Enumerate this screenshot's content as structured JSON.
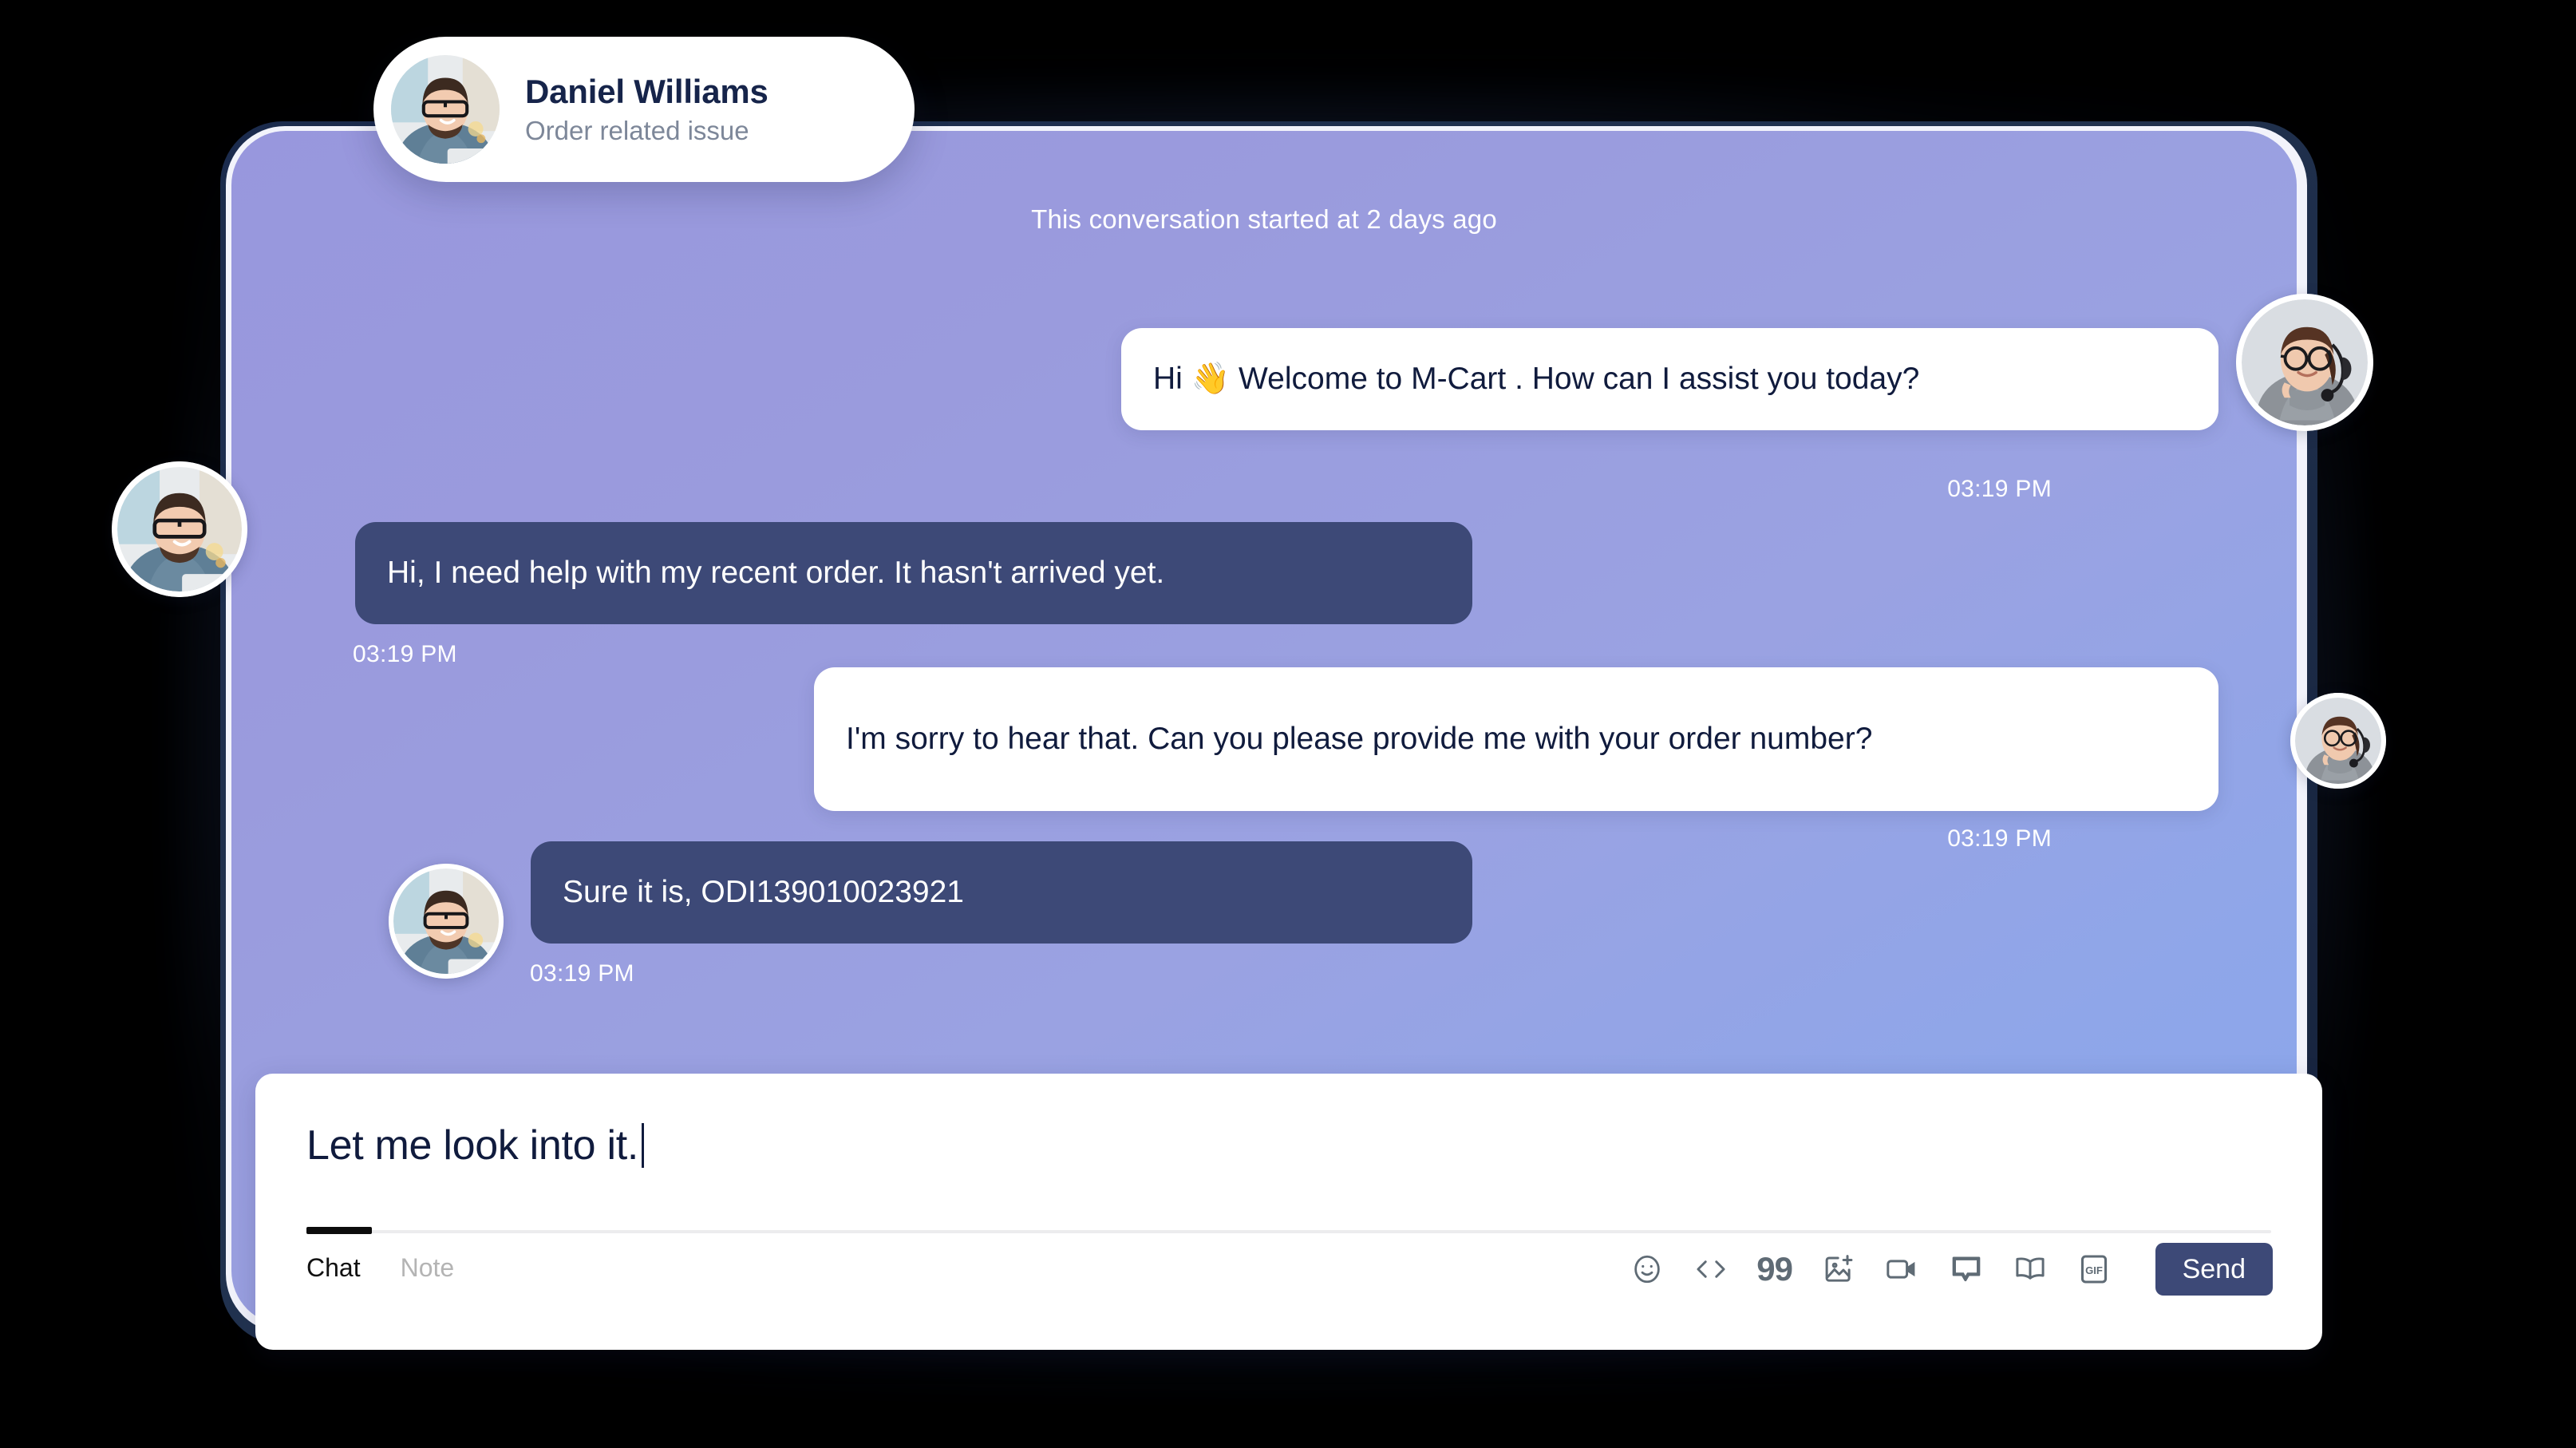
{
  "header": {
    "name": "Daniel Williams",
    "subtitle": "Order related issue",
    "avatar_name": "customer-avatar"
  },
  "conversation": {
    "start_notice": "This conversation started at 2 days ago",
    "messages": [
      {
        "id": "msg-1",
        "sender": "agent",
        "text": "Hi 👋 Welcome to M-Cart . How can I assist you today?",
        "time": "03:19 PM"
      },
      {
        "id": "msg-2",
        "sender": "customer",
        "text": "Hi, I need help with my recent order. It hasn't arrived yet.",
        "time": "03:19 PM"
      },
      {
        "id": "msg-3",
        "sender": "agent",
        "text": "I'm sorry to hear that. Can you please provide me with your order number?",
        "time": "03:19 PM"
      },
      {
        "id": "msg-4",
        "sender": "customer",
        "text": "Sure it is, ODI139010023921",
        "time": "03:19 PM"
      }
    ]
  },
  "composer": {
    "draft_text": "Let me look into it.",
    "tabs": [
      {
        "label": "Chat",
        "active": true
      },
      {
        "label": "Note",
        "active": false
      }
    ],
    "tools": [
      {
        "name": "emoji-icon",
        "label": ""
      },
      {
        "name": "code-icon",
        "label": ""
      },
      {
        "name": "quote-icon",
        "label": "99"
      },
      {
        "name": "add-image-icon",
        "label": ""
      },
      {
        "name": "video-icon",
        "label": ""
      },
      {
        "name": "canned-response-icon",
        "label": ""
      },
      {
        "name": "knowledge-base-icon",
        "label": ""
      },
      {
        "name": "gif-icon",
        "label": "GIF"
      }
    ],
    "send_label": "Send"
  },
  "colors": {
    "panel_gradient_start": "#9897dd",
    "panel_gradient_end": "#8aa6ec",
    "customer_bubble": "#3d4977",
    "agent_bubble": "#ffffff",
    "agent_bubble_text": "#101b3d",
    "send_button": "#3d4977",
    "device_frame": "#1b2b4d",
    "header_name_color": "#16244a",
    "header_subtitle_color": "#7d8799",
    "timestamp_color": "#ffffff"
  }
}
